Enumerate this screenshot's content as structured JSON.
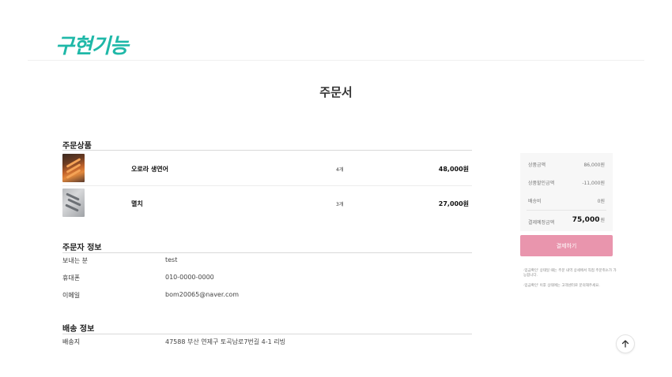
{
  "header": {
    "title": "구현기능"
  },
  "page": {
    "title": "주문서"
  },
  "order_products": {
    "section_title": "주문상품",
    "items": [
      {
        "name": "오로라 생연어",
        "qty": "4개",
        "price": "48,000원"
      },
      {
        "name": "멸치",
        "qty": "3개",
        "price": "27,000원"
      }
    ]
  },
  "orderer": {
    "section_title": "주문자 정보",
    "rows": [
      {
        "label": "보내는 분",
        "value": "test"
      },
      {
        "label": "휴대폰",
        "value": "010-0000-0000"
      },
      {
        "label": "이메일",
        "value": "bom20065@naver.com"
      }
    ]
  },
  "shipping": {
    "section_title": "배송 정보",
    "rows": [
      {
        "label": "배송지",
        "value": "47588 부산 연제구 토곡남로7번길 4-1 리빙"
      }
    ]
  },
  "summary": {
    "rows": [
      {
        "label": "상품금액",
        "value": "86,000원"
      },
      {
        "label": "상품할인금액",
        "value": "-11,000원"
      },
      {
        "label": "배송비",
        "value": "0원"
      }
    ],
    "total_label": "결제예정금액",
    "total_value": "75,000",
    "total_unit": "원",
    "pay_button": "결제하기",
    "notices": [
      "·입금확인' 상태일 때는 주문 내역 상세에서 직접 주문취소가 가능합니다.",
      "·입금확인' 이후 상태에는 고객센터로 문의해주세요."
    ]
  },
  "colors": {
    "accent_title": "#1fb8a8",
    "pay_button": "#e995ad"
  },
  "icons": {
    "scroll_top": "arrow-up-icon"
  }
}
